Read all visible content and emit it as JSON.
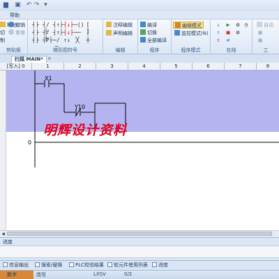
{
  "menu": {
    "help": "帮助"
  },
  "ribbon": {
    "clipboard": {
      "label": "剪贴板",
      "paste": "粘贴",
      "cut": "切",
      "copy": "制",
      "undo": "撤销",
      "redo": "重做"
    },
    "ladder_symbols": {
      "label": "梯形图符号"
    },
    "edit": {
      "label": "编辑",
      "annotate": "注释编辑",
      "declare": "声明编辑"
    },
    "program": {
      "label": "程序",
      "compile": "编译",
      "switch": "切换",
      "compile_all": "全部编译"
    },
    "program_mode": {
      "label": "程序模式",
      "edit_mode": "编辑模式",
      "monitor_mode": "监控模式(N)"
    },
    "online": {
      "label": "在线"
    },
    "tools": {
      "label": "工",
      "auto": "自动"
    }
  },
  "tabs": {
    "main": "扫描 MAIN*",
    "close": "×"
  },
  "column_header": {
    "write": "[写入] 0",
    "columns": [
      "1",
      "2",
      "3",
      "4",
      "5",
      "6",
      "7",
      "8"
    ]
  },
  "ladder": {
    "contact_x1": "X1",
    "contact_y10": "Y10",
    "row_number": "0"
  },
  "watermark": "明辉设计资料",
  "progress": {
    "title": "进度"
  },
  "bottom_tabs": [
    "信息输出",
    "搜索/替换",
    "PLC校验结果",
    "软元件使用列表",
    "进度"
  ],
  "status": {
    "lang": "数字",
    "mode": "改写",
    "model": "LXSV",
    "position": "0/2"
  },
  "colors": {
    "selection": "#b4b4f0",
    "watermark": "#e4001d",
    "ribbon_bg": "#dce7f5"
  }
}
